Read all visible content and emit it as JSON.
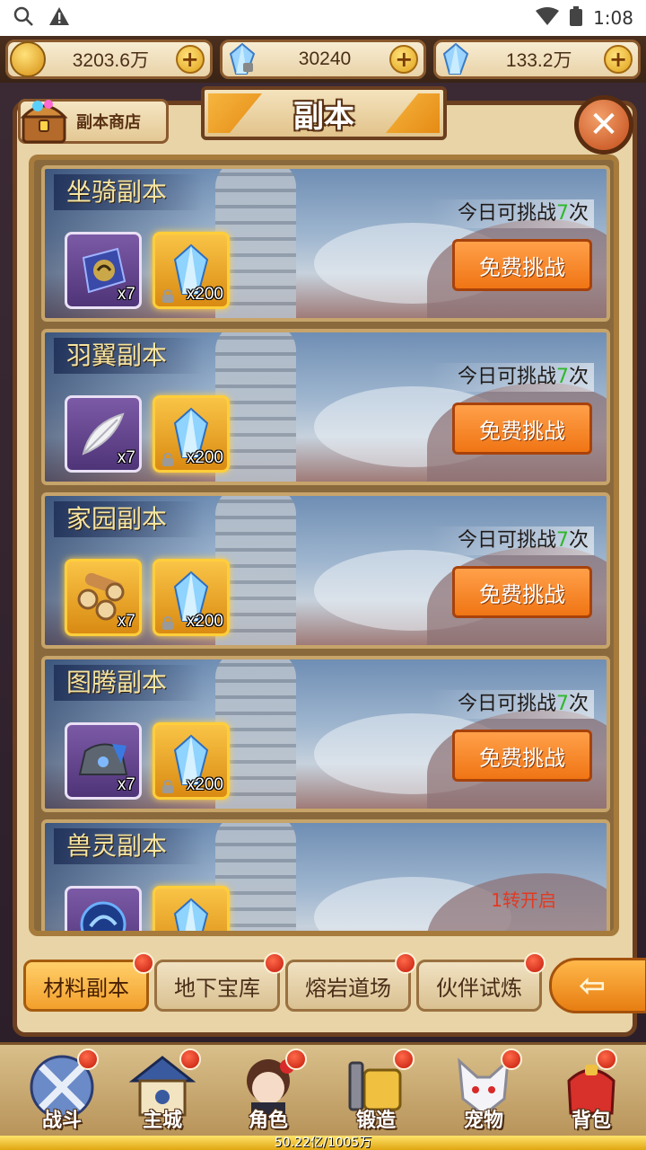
{
  "status_bar": {
    "time": "1:08"
  },
  "currencies": [
    {
      "icon": "gold-coin-icon",
      "value": "3203.6万"
    },
    {
      "icon": "locked-crystal-icon",
      "value": "30240"
    },
    {
      "icon": "crystal-icon",
      "value": "133.2万"
    }
  ],
  "panel": {
    "title": "副本",
    "shop_label": "副本商店"
  },
  "dungeons": [
    {
      "name": "坐骑副本",
      "times_prefix": "今日可挑战",
      "times_num": "7",
      "times_suffix": "次",
      "button": "免费挑战",
      "reward1": "x7",
      "reward2": "x200",
      "reward1_icon": "mount-token-icon"
    },
    {
      "name": "羽翼副本",
      "times_prefix": "今日可挑战",
      "times_num": "7",
      "times_suffix": "次",
      "button": "免费挑战",
      "reward1": "x7",
      "reward2": "x200",
      "reward1_icon": "feather-icon"
    },
    {
      "name": "家园副本",
      "times_prefix": "今日可挑战",
      "times_num": "7",
      "times_suffix": "次",
      "button": "免费挑战",
      "reward1": "x7",
      "reward2": "x200",
      "reward1_icon": "wood-logs-icon"
    },
    {
      "name": "图腾副本",
      "times_prefix": "今日可挑战",
      "times_num": "7",
      "times_suffix": "次",
      "button": "免费挑战",
      "reward1": "x7",
      "reward2": "x200",
      "reward1_icon": "totem-stone-icon"
    },
    {
      "name": "兽灵副本",
      "unlock": "1转开启",
      "reward1_icon": "beast-orb-icon"
    }
  ],
  "tabs": [
    "材料副本",
    "地下宝库",
    "熔岩道场",
    "伙伴试炼"
  ],
  "bottom_nav": [
    "战斗",
    "主城",
    "角色",
    "锻造",
    "宠物",
    "背包"
  ],
  "xp": {
    "text": "50.22亿/1005万",
    "fraction": 1.0
  },
  "colors": {
    "accent": "#f07514",
    "times_num": "#2fb82a",
    "unlock": "#e23a22"
  }
}
